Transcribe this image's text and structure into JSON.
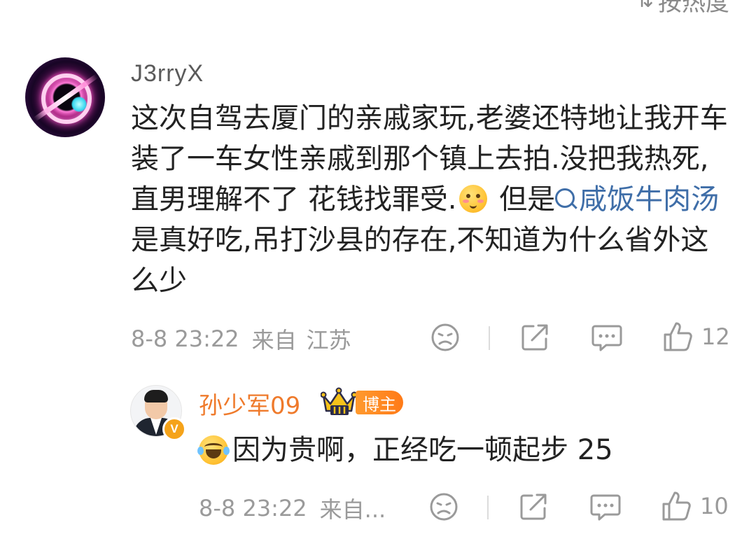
{
  "sort": {
    "label": "按热度",
    "icon": "sort-icon"
  },
  "comment": {
    "username": "J3rryX",
    "text_part1": "这次自驾去厦门的亲戚家玩,老婆还特地让我开车装了一车女性亲戚到那个镇上去拍.没把我热死,直男理解不了 花钱找罪受.",
    "emoji_1": "blush-emoji",
    "text_part2": " 但是",
    "topic_link": "咸饭牛肉汤",
    "text_part3": " 是真好吃,吊打沙县的存在,不知道为什么省外这么少",
    "date": "8-8 23:22",
    "from": "来自",
    "location": "江苏",
    "like_count": "12"
  },
  "reply": {
    "username": "孙少军09",
    "badge": "博主",
    "crown_icon": "crown-level-3-icon",
    "verified_badge": "V",
    "emoji": "laughing-tears-emoji",
    "text": "因为贵啊，正经吃一顿起步 25",
    "date": "8-8 23:22",
    "meta_truncated": "来自...",
    "like_count": "10"
  },
  "colors": {
    "link": "#3f6ea8",
    "reply_name": "#ef7a2b",
    "meta": "#9a9a9a",
    "badge": "#ff8a1f"
  }
}
